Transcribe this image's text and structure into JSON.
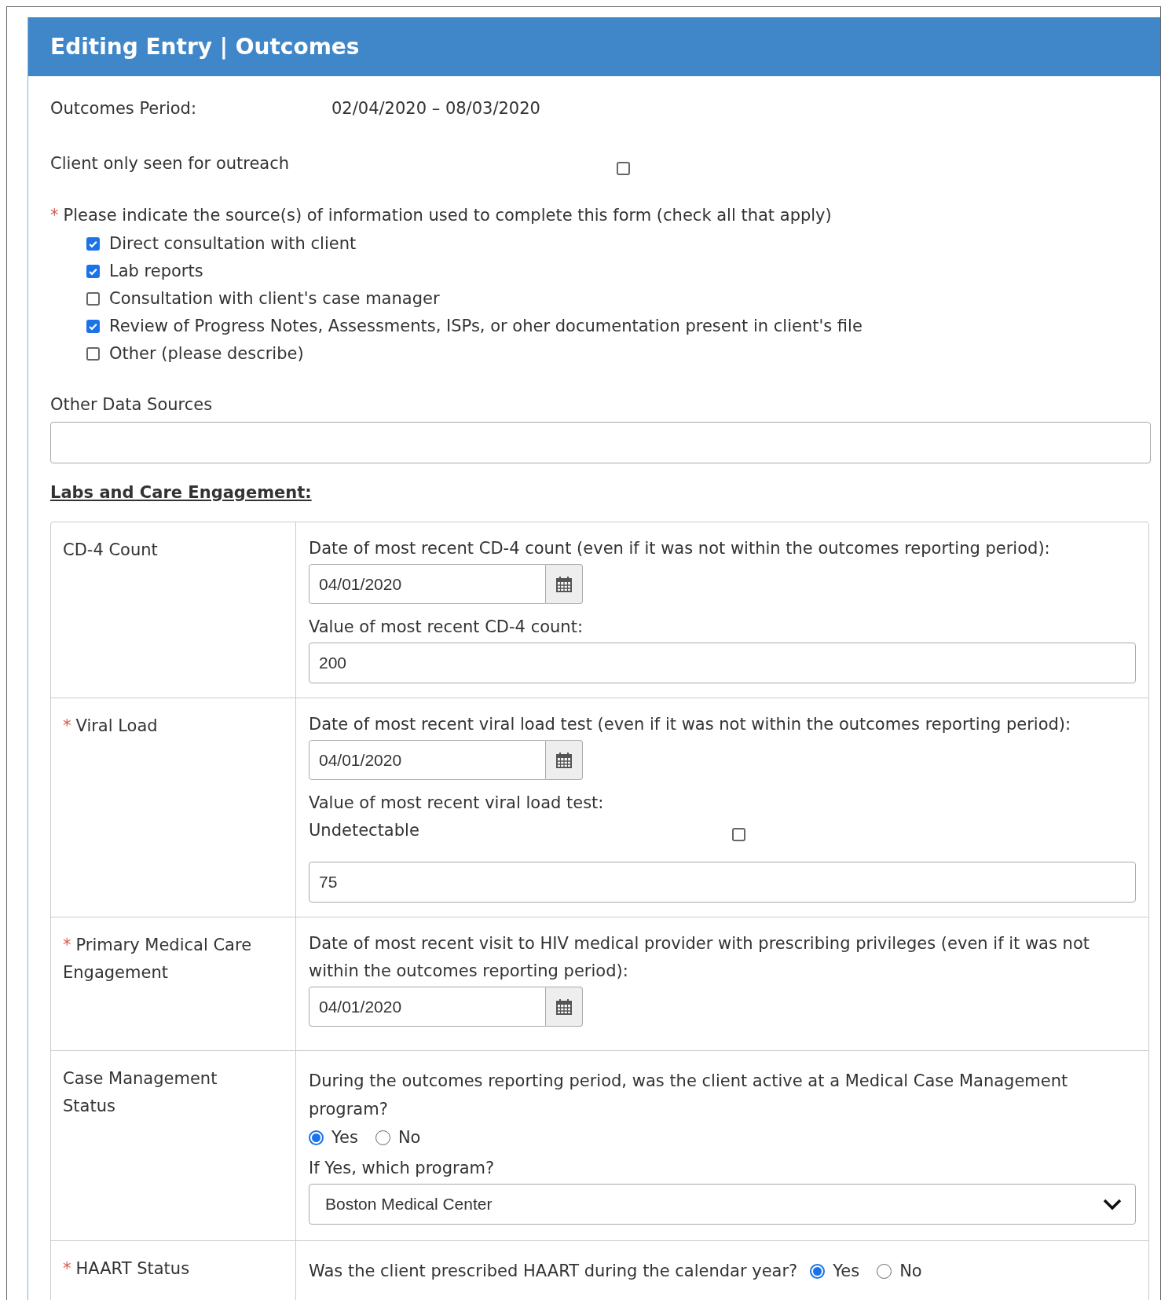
{
  "panel": {
    "title": "Editing Entry | Outcomes"
  },
  "period": {
    "label": "Outcomes Period:",
    "value": "02/04/2020 – 08/03/2020"
  },
  "outreach": {
    "label": "Client only seen for outreach",
    "checked": false
  },
  "sources": {
    "marker": "*",
    "question": "Please indicate the source(s) of information used to complete this form (check all that apply)",
    "options": [
      {
        "label": "Direct consultation with client",
        "checked": true
      },
      {
        "label": "Lab reports",
        "checked": true
      },
      {
        "label": "Consultation with client's case manager",
        "checked": false
      },
      {
        "label": "Review of Progress Notes, Assessments, ISPs, or oher documentation present in client's file",
        "checked": true
      },
      {
        "label": "Other (please describe)",
        "checked": false
      }
    ]
  },
  "other_sources": {
    "label": "Other Data Sources"
  },
  "section_heading": "Labs and Care Engagement:",
  "rows": [
    {
      "label": "CD-4 Count",
      "fields": [
        {
          "kind": "date",
          "label": "Date of most recent CD-4 count (even if it was not within the outcomes reporting period):",
          "value": "04/01/2020"
        },
        {
          "kind": "text",
          "label": "Value of most recent CD-4 count:",
          "value": "200"
        }
      ]
    },
    {
      "marker": "*",
      "label": "Viral Load",
      "fields": [
        {
          "kind": "date",
          "label": "Date of most recent viral load test (even if it was not within the outcomes reporting period):",
          "value": "04/01/2020"
        },
        {
          "kind": "note",
          "label": "Value of most recent viral load test:"
        },
        {
          "kind": "checkbox",
          "label": "Undetectable",
          "checked": false
        },
        {
          "kind": "text",
          "value": "75"
        }
      ]
    },
    {
      "marker": "*",
      "label": "Primary Medical Care Engagement",
      "fields": [
        {
          "kind": "date",
          "label": "Date of most recent visit to HIV medical provider with prescribing privileges (even if it was not within the outcomes reporting period):",
          "value": "04/01/2020"
        }
      ]
    },
    {
      "label": "Case Management Status",
      "fields": [
        {
          "kind": "radio",
          "question": "During the outcomes reporting period, was the client active at a Medical Case Management program?",
          "options": [
            {
              "label": "Yes",
              "selected": true
            },
            {
              "label": "No",
              "selected": false
            }
          ]
        },
        {
          "kind": "select",
          "label": "If Yes, which program?",
          "value": "Boston Medical Center"
        }
      ]
    },
    {
      "marker": "*",
      "label": "HAART Status",
      "fields": [
        {
          "kind": "radio",
          "question": "Was the client prescribed HAART during the calendar year?",
          "options": [
            {
              "label": "Yes",
              "selected": true
            },
            {
              "label": "No",
              "selected": false
            }
          ]
        }
      ]
    }
  ]
}
